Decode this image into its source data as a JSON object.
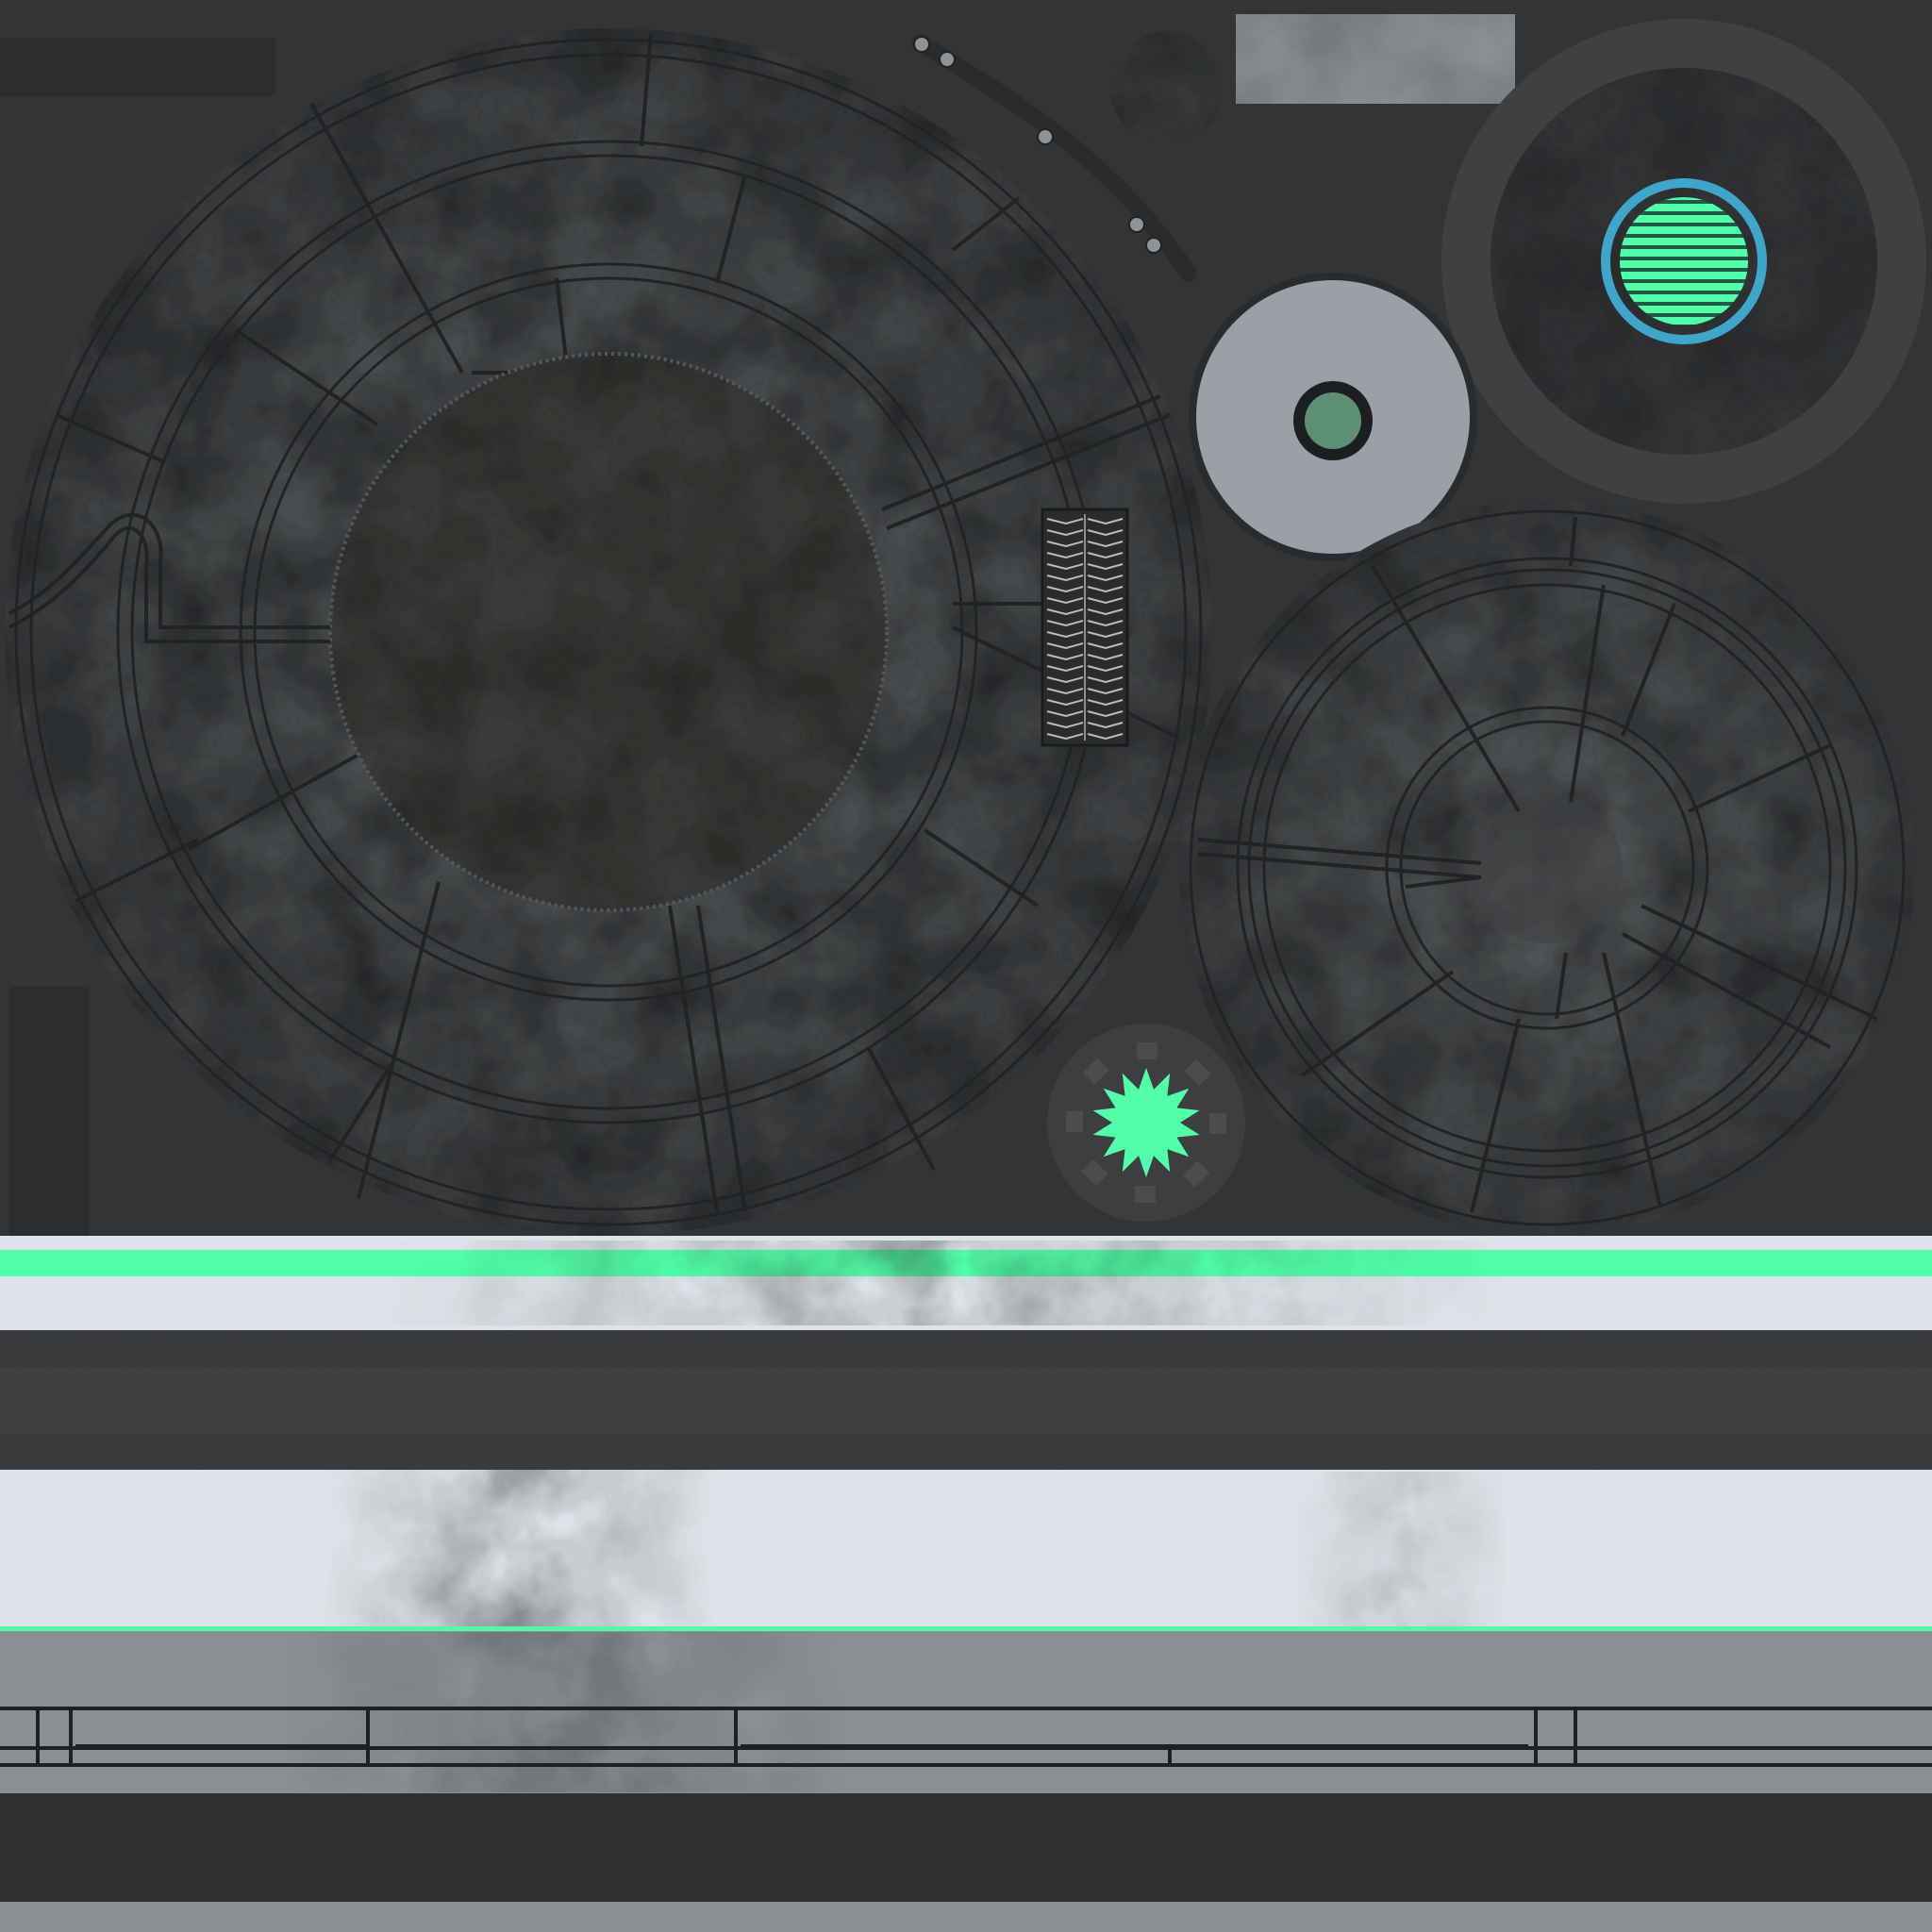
{
  "image": {
    "kind": "texture-atlas",
    "background": "#333436"
  },
  "palette": {
    "accent_green": "#52ffa8",
    "accent_blue": "#3fa6c9",
    "panel_dark": "#3a3b3c",
    "panel_light": "#dde3e8",
    "steel": "#8a8f93",
    "button_grey": "#9aa0a5",
    "line_dark": "#1f2021"
  },
  "components": {
    "large_disc": "large-mechanical-disc",
    "small_disc": "small-mechanical-disc",
    "grey_button": "grey-ring-button",
    "vent_disc": "vent-disc-icon",
    "starburst": "starburst-icon",
    "vent_grille": "vent-grille",
    "slot_arc": "slot-arc",
    "label_plate": "label-plate",
    "bands": [
      "light-band-top",
      "dark-band",
      "light-band-middle",
      "steel-rail-band",
      "bottom-dark-band"
    ]
  }
}
